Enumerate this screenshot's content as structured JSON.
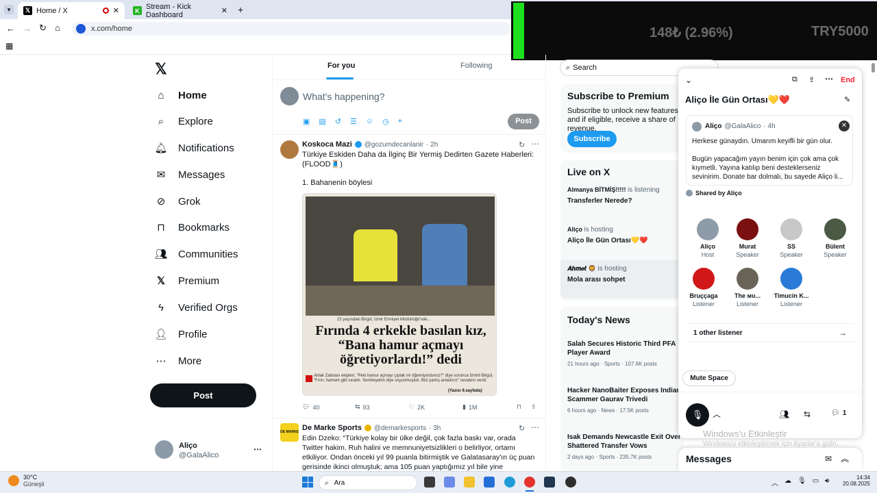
{
  "browser": {
    "tabs": [
      {
        "title": "Home / X",
        "active": true
      },
      {
        "title": "Stream - Kick Dashboard",
        "active": false
      }
    ],
    "url": "x.com/home"
  },
  "overlay": {
    "amount": "148₺ (2.96%)",
    "goal": "TRY5000"
  },
  "nav": {
    "items": [
      "Home",
      "Explore",
      "Notifications",
      "Messages",
      "Grok",
      "Bookmarks",
      "Communities",
      "Premium",
      "Verified Orgs",
      "Profile",
      "More"
    ],
    "post_label": "Post"
  },
  "account": {
    "name": "Aliço",
    "handle": "@GalaAlico"
  },
  "feed": {
    "tabs": [
      "For you",
      "Following"
    ],
    "composer_placeholder": "What's happening?",
    "composer_post": "Post",
    "tweets": [
      {
        "name": "Koskoca Mazi",
        "handle": "@gozumdecanlanir",
        "time": "· 2h",
        "text1": "Türkiye Eskiden Daha da İlginç Bir Yermiş Dedirten Gazete Haberleri: (FLOOD🧵)",
        "text2": "1. Bahanenin böylesi",
        "clip_caption": "22 yaşındaki Birgül, İzmir Emniyet Müdürlüğü'nde...",
        "clip_headline": "Fırında 4 erkekle basılan kız, “Bana hamur açmayı öğretiyorlardı!” dedi",
        "clip_body": "Ahlak Zabıtası ekipleri, \"Peki hamur açmayı çıplak mı öğreniyordunuz?\" diye sorunca İzmirli Birgül, \"Fırın, hamam gibi sıcaktı. Serinleyelim diye soyunmuştuk. Bizi yanlış anladınız\" cevabını verdi.",
        "clip_page": "(Yazısı 9.sayfada)",
        "replies": "40",
        "reposts": "93",
        "likes": "2K",
        "views": "1M"
      },
      {
        "name": "De Marke Sports",
        "handle": "@demarkesports",
        "time": "· 3h",
        "avatar_label": "DE MARKE",
        "text": "Edin Dzeko: “Türkiye kolay bir ülke değil, çok fazla baskı var, orada Twitter hakim. Ruh halini ve memnuniyetsizlikleri o belirliyor, ortamı etkiliyor. Ondan önceki yıl 99 puanla bitirmiştik ve Galatasaray'ın üç puan gerisinde ikinci olmuştuk; ama 105 puan yaptığımız yıl bile yine"
      }
    ]
  },
  "right": {
    "search_placeholder": "Search",
    "premium": {
      "title": "Subscribe to Premium",
      "body": "Subscribe to unlock new features and if eligible, receive a share of revenue.",
      "button": "Subscribe"
    },
    "live": {
      "title": "Live on X",
      "items": [
        {
          "host": "Almanya BİTMİŞ!!!!!",
          "status": "is listening",
          "title": "Transferler Nerede?"
        },
        {
          "host": "Aliço",
          "status": "is hosting",
          "title": "Aliço İle Gün Ortası💛❤️"
        },
        {
          "host": "𝑨𝒉𝒎𝒆𝒕 🦁",
          "status": "is hosting",
          "title": "Mola arası sohpet"
        }
      ]
    },
    "news": {
      "title": "Today's News",
      "items": [
        {
          "headline": "Salah Secures Historic Third PFA Player Award",
          "meta": "21 hours ago · Sports · 107.6K posts"
        },
        {
          "headline": "Hacker NanoBaiter Exposes Indian Scammer Gaurav Trivedi",
          "meta": "6 hours ago · News · 17.5K posts"
        },
        {
          "headline": "Isak Demands Newcastle Exit Over Shattered Transfer Vows",
          "meta": "2 days ago · Sports · 235.7K posts"
        }
      ]
    }
  },
  "space": {
    "end_label": "End",
    "title": "Aliço İle Gün Ortası💛❤️",
    "pinned": {
      "name": "Aliço",
      "handle": "@GalaAlico",
      "time": "· 4h",
      "line1": "Herkese günaydın. Umarım keyifli bir gün olur.",
      "line2": "Bugün yapacağım yayın benim için çok ama çok kıymetli. Yayına katılıp beni desteklerseniz sevinirim. Donate bar dolmalı, bu sayede Aliço li..."
    },
    "shared_by": "Shared by Aliço",
    "people": [
      {
        "name": "Aliço",
        "role": "Host"
      },
      {
        "name": "Murat",
        "role": "Speaker"
      },
      {
        "name": "SS",
        "role": "Speaker"
      },
      {
        "name": "Bülent",
        "role": "Speaker"
      },
      {
        "name": "Bruççaga",
        "role": "Listener"
      },
      {
        "name": "The мυ...",
        "role": "Listener"
      },
      {
        "name": "Timucin K...",
        "role": "Listener"
      }
    ],
    "other_listener": "1 other listener",
    "mute": "Mute Space",
    "reply_count": "1",
    "watermark1": "Windows'u Etkinleştir",
    "watermark2": "Windows'u etkinleştirmek için Ayarlar'a gidin."
  },
  "messages": {
    "title": "Messages"
  },
  "taskbar": {
    "weather_temp": "30°C",
    "weather_text": "Güneşli",
    "search": "Ara",
    "time": "14:34",
    "date": "20.08.2025"
  }
}
